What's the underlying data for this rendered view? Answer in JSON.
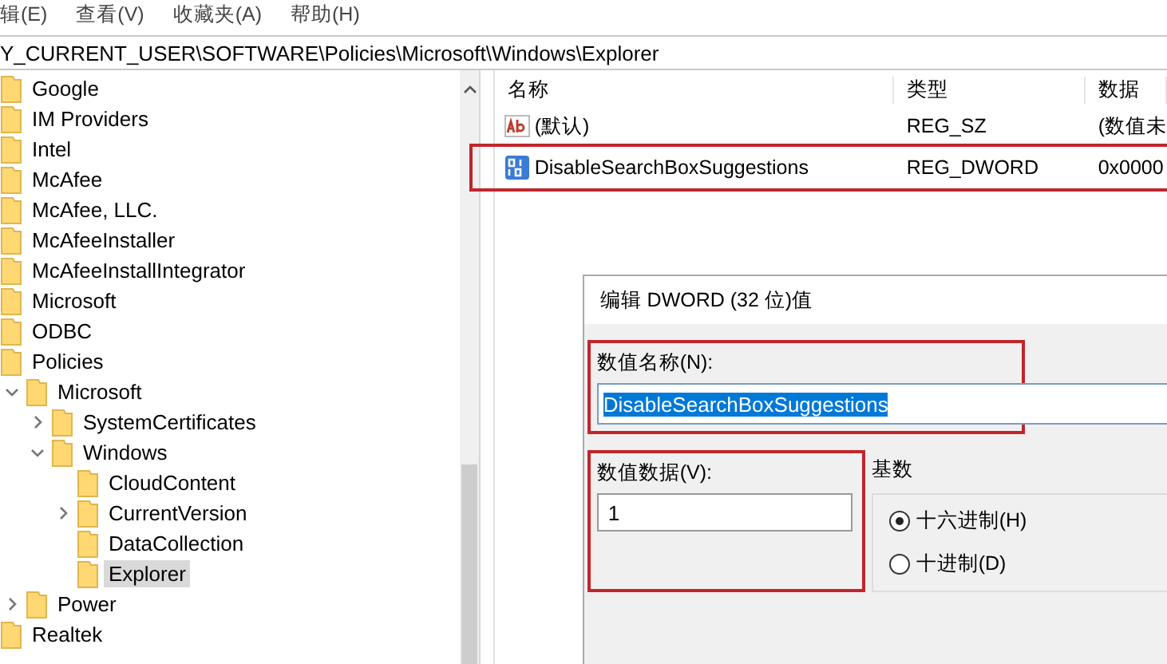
{
  "menu": [
    {
      "label": "辑(E)"
    },
    {
      "label": "查看(V)"
    },
    {
      "label": "收藏夹(A)"
    },
    {
      "label": "帮助(H)"
    }
  ],
  "address": "Y_CURRENT_USER\\SOFTWARE\\Policies\\Microsoft\\Windows\\Explorer",
  "tree": [
    {
      "label": "Google",
      "selected": false
    },
    {
      "label": "IM Providers",
      "selected": false
    },
    {
      "label": "Intel",
      "selected": false
    },
    {
      "label": "McAfee",
      "selected": false
    },
    {
      "label": "McAfee, LLC.",
      "selected": false
    },
    {
      "label": "McAfeeInstaller",
      "selected": false
    },
    {
      "label": "McAfeeInstallIntegrator",
      "selected": false
    },
    {
      "label": "Microsoft",
      "selected": false
    },
    {
      "label": "ODBC",
      "selected": false
    },
    {
      "label": "Policies",
      "selected": false,
      "children": [
        {
          "label": "Microsoft",
          "selected": false,
          "expanded": true,
          "children": [
            {
              "label": "SystemCertificates",
              "selected": false,
              "expanded": false
            },
            {
              "label": "Windows",
              "selected": false,
              "expanded": true,
              "children": [
                {
                  "label": "CloudContent",
                  "selected": false
                },
                {
                  "label": "CurrentVersion",
                  "selected": false,
                  "expanded": false
                },
                {
                  "label": "DataCollection",
                  "selected": false
                },
                {
                  "label": "Explorer",
                  "selected": true
                }
              ]
            }
          ]
        },
        {
          "label": "Power",
          "selected": false,
          "expanded": false
        }
      ]
    },
    {
      "label": "Realtek",
      "selected": false
    }
  ],
  "columns": [
    "名称",
    "类型",
    "数据"
  ],
  "values": [
    {
      "kind": "string",
      "name": "(默认)",
      "type": "REG_SZ",
      "data": "(数值未",
      "highlighted": false
    },
    {
      "kind": "dword",
      "name": "DisableSearchBoxSuggestions",
      "type": "REG_DWORD",
      "data": "0x0000",
      "highlighted": true
    }
  ],
  "dialog": {
    "title": "编辑 DWORD (32 位)值",
    "name_label": "数值名称(N):",
    "name_value": "DisableSearchBoxSuggestions",
    "name_highlighted": true,
    "data_label": "数值数据(V):",
    "data_value": "1",
    "data_highlighted": true,
    "base_label": "基数",
    "base_options": [
      {
        "label": "十六进制(H)",
        "selected": true
      },
      {
        "label": "十进制(D)",
        "selected": false
      }
    ]
  }
}
